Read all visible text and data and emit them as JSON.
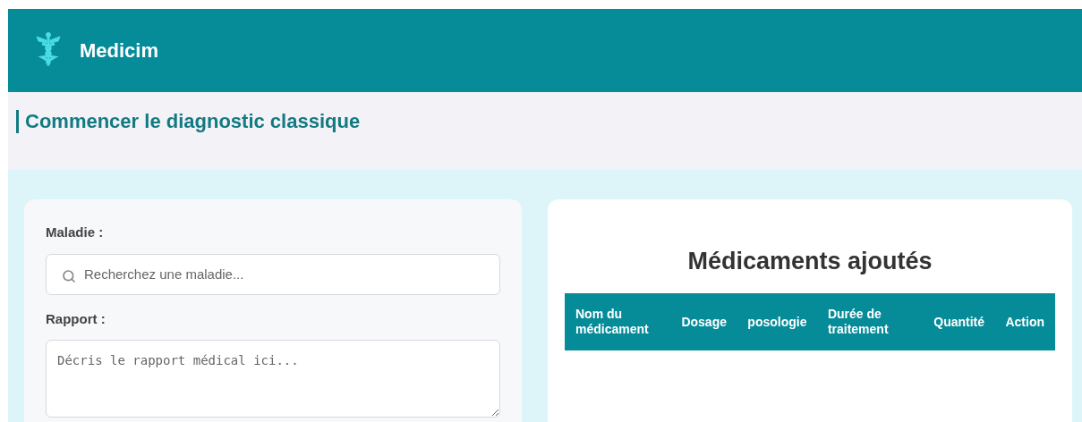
{
  "header": {
    "brand": "Medicim"
  },
  "page_title": "Commencer le diagnostic classique",
  "form": {
    "fields": [
      {
        "kind": "search",
        "label": "Maladie :",
        "placeholder": "Recherchez une maladie..."
      },
      {
        "kind": "textarea",
        "label": "Rapport :",
        "placeholder": "Décris le rapport médical ici..."
      }
    ]
  },
  "medications": {
    "title": "Médicaments ajoutés",
    "table": {
      "columns": [
        "Nom du médicament",
        "Dosage",
        "posologie",
        "Durée de traitement",
        "Quantité",
        "Action"
      ]
    }
  }
}
